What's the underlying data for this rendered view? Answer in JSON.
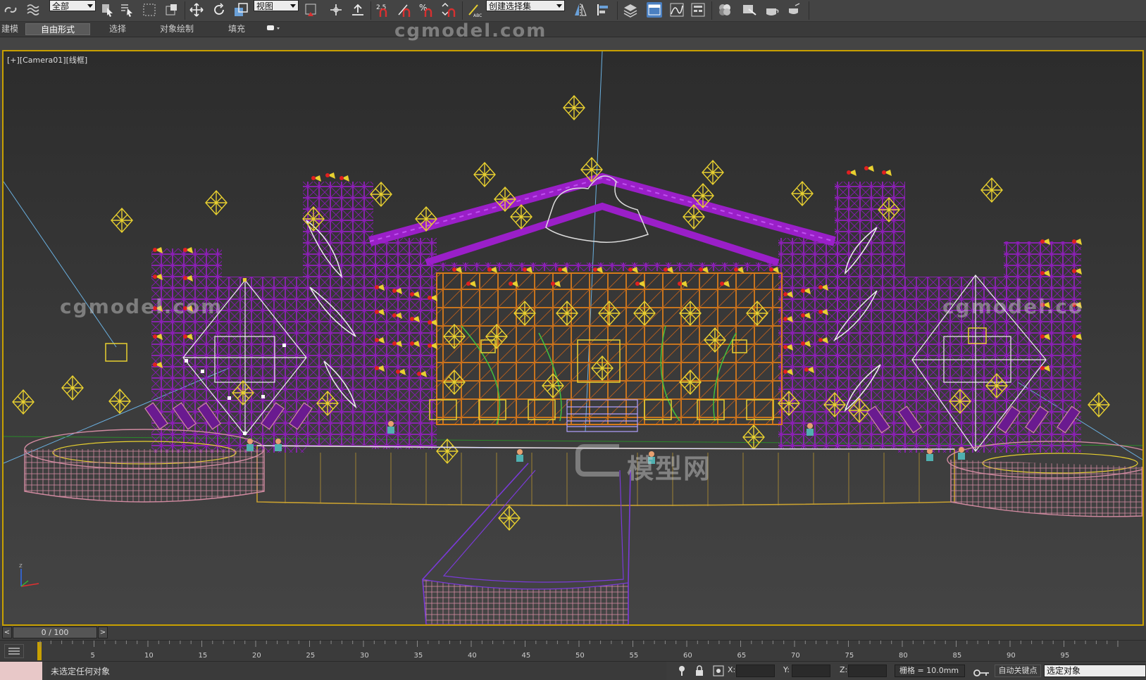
{
  "toolbar": {
    "selection_filter": "全部",
    "reference_coord": "视图",
    "named_selection_set": "创建选择集",
    "snap_angle_value": "2.5",
    "percent_snap": "%"
  },
  "ribbon": {
    "tabs": [
      "建模",
      "自由形式",
      "选择",
      "对象绘制",
      "填充"
    ],
    "active_tab": "自由形式"
  },
  "viewport": {
    "label_plus": "[+]",
    "label_camera": "[Camera01]",
    "label_mode": "[线框]",
    "watermark_top": "cgmodel.com",
    "watermark_left": "cgmodel.com",
    "watermark_right": "cgmodel.co",
    "watermark_center": "模型网",
    "axis_z": "z"
  },
  "timeline": {
    "frame_display": "0 / 100",
    "prev": "<",
    "next": ">",
    "ticks": [
      "5",
      "10",
      "15",
      "20",
      "25",
      "30",
      "35",
      "40",
      "45",
      "50",
      "55",
      "60",
      "65",
      "70",
      "75",
      "80",
      "85",
      "90",
      "95"
    ]
  },
  "status": {
    "message": "未选定任何对象",
    "x_label": "X:",
    "y_label": "Y:",
    "z_label": "Z:",
    "x_value": "",
    "y_value": "",
    "z_value": "",
    "grid": "栅格 = 10.0mm",
    "auto_key": "自动关键点",
    "selected_dropdown": "选定对象"
  },
  "colors": {
    "viewport_border": "#c8a000",
    "truss": "#9a1fc8",
    "grid_orange": "#d77a1a",
    "light_yellow": "#e8d030",
    "stage_pink": "#d08aa0",
    "stage_yellow": "#c8a030"
  }
}
